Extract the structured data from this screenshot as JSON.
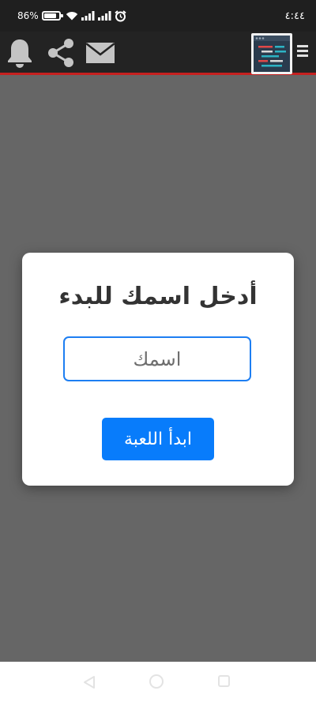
{
  "status_bar": {
    "battery_percent": "86%",
    "battery_level": 0.86,
    "time": "٤:٤٤",
    "icons": [
      "battery-icon",
      "wifi-icon",
      "signal-icon",
      "signal-icon-2",
      "alarm-icon"
    ]
  },
  "header": {
    "icons": [
      "bell-icon",
      "share-icon",
      "mail-icon",
      "app-logo",
      "menu-icon"
    ],
    "accent_color": "#c6201f",
    "background_color": "#232323"
  },
  "dialog": {
    "title": "أدخل اسمك للبدء",
    "name_input": {
      "placeholder": "اسمك",
      "value": ""
    },
    "start_button_label": "ابدأ اللعبة",
    "button_color": "#087cfb",
    "input_border_color": "#1d7ef2"
  },
  "nav_bar": {
    "icons": [
      "back-icon",
      "home-icon",
      "recent-apps-icon"
    ]
  }
}
